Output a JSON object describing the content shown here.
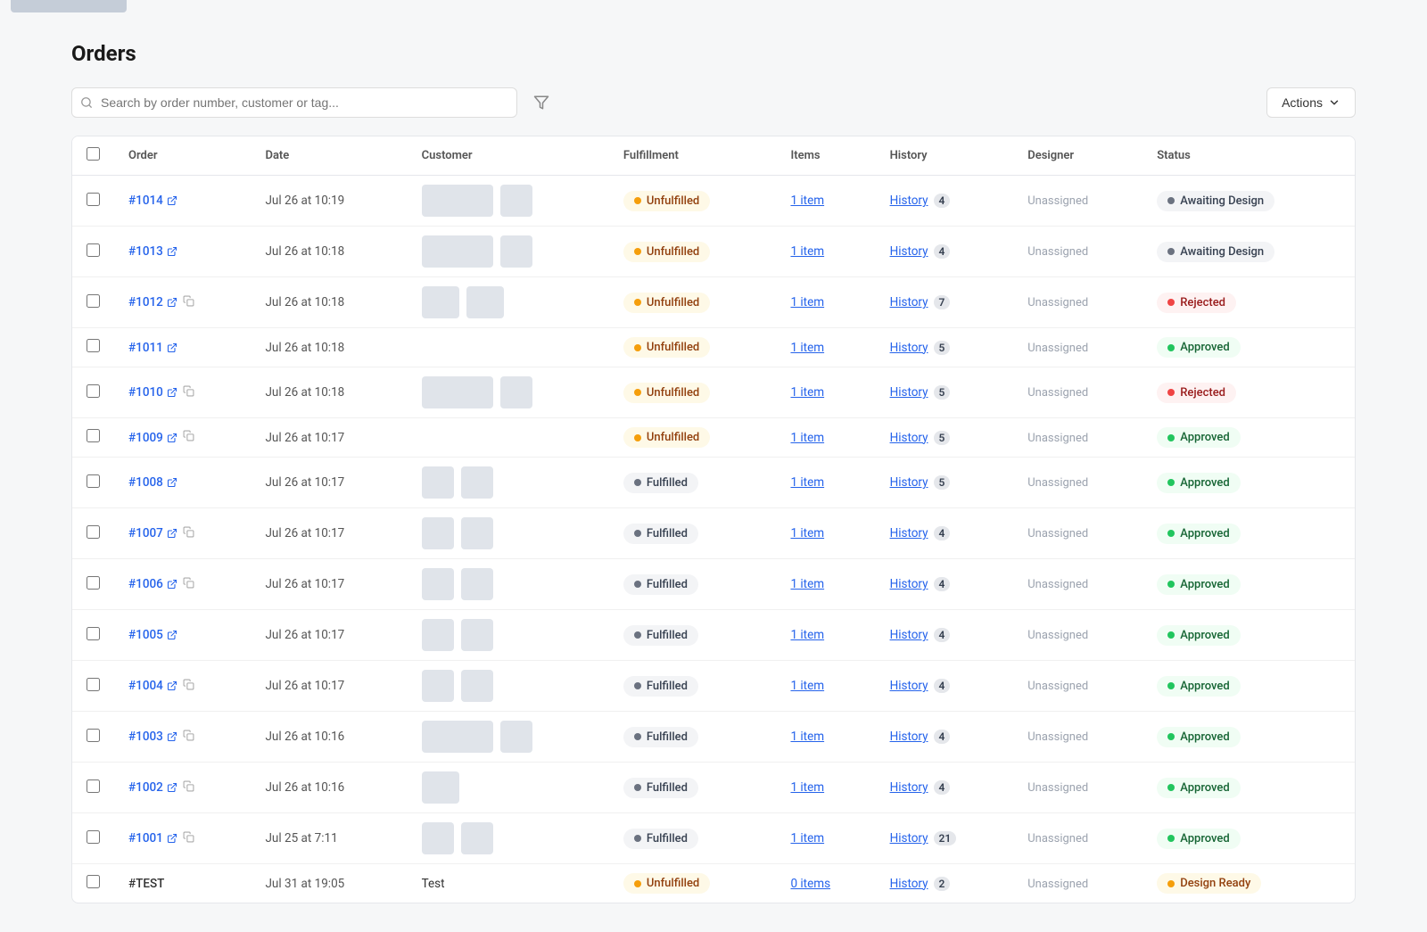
{
  "topbar": {
    "label": "top-bar"
  },
  "page": {
    "title": "Orders"
  },
  "toolbar": {
    "search_placeholder": "Search by order number, customer or tag...",
    "actions_label": "Actions"
  },
  "table": {
    "columns": [
      "",
      "Order",
      "Date",
      "Customer",
      "Fulfillment",
      "Items",
      "History",
      "Designer",
      "Status"
    ],
    "rows": [
      {
        "id": "row-1014",
        "order": "#1014",
        "date": "Jul 26 at 10:19",
        "has_customer_image": true,
        "image_type": "wide",
        "fulfillment": "Unfulfilled",
        "fulfillment_type": "unfulfilled",
        "items": "1 item",
        "history": "History",
        "history_count": 4,
        "designer": "Unassigned",
        "status": "Awaiting Design",
        "status_type": "awaiting",
        "has_copy": false
      },
      {
        "id": "row-1013",
        "order": "#1013",
        "date": "Jul 26 at 10:18",
        "has_customer_image": true,
        "image_type": "wide",
        "fulfillment": "Unfulfilled",
        "fulfillment_type": "unfulfilled",
        "items": "1 item",
        "history": "History",
        "history_count": 4,
        "designer": "Unassigned",
        "status": "Awaiting Design",
        "status_type": "awaiting",
        "has_copy": false
      },
      {
        "id": "row-1012",
        "order": "#1012",
        "date": "Jul 26 at 10:18",
        "has_customer_image": true,
        "image_type": "pair",
        "fulfillment": "Unfulfilled",
        "fulfillment_type": "unfulfilled",
        "items": "1 item",
        "history": "History",
        "history_count": 7,
        "designer": "Unassigned",
        "status": "Rejected",
        "status_type": "rejected",
        "has_copy": true
      },
      {
        "id": "row-1011",
        "order": "#1011",
        "date": "Jul 26 at 10:18",
        "has_customer_image": false,
        "image_type": "none",
        "fulfillment": "Unfulfilled",
        "fulfillment_type": "unfulfilled",
        "items": "1 item",
        "history": "History",
        "history_count": 5,
        "designer": "Unassigned",
        "status": "Approved",
        "status_type": "approved",
        "has_copy": false
      },
      {
        "id": "row-1010",
        "order": "#1010",
        "date": "Jul 26 at 10:18",
        "has_customer_image": true,
        "image_type": "wide",
        "fulfillment": "Unfulfilled",
        "fulfillment_type": "unfulfilled",
        "items": "1 item",
        "history": "History",
        "history_count": 5,
        "designer": "Unassigned",
        "status": "Rejected",
        "status_type": "rejected",
        "has_copy": true
      },
      {
        "id": "row-1009",
        "order": "#1009",
        "date": "Jul 26 at 10:17",
        "has_customer_image": false,
        "image_type": "none",
        "fulfillment": "Unfulfilled",
        "fulfillment_type": "unfulfilled",
        "items": "1 item",
        "history": "History",
        "history_count": 5,
        "designer": "Unassigned",
        "status": "Approved",
        "status_type": "approved",
        "has_copy": true
      },
      {
        "id": "row-1008",
        "order": "#1008",
        "date": "Jul 26 at 10:17",
        "has_customer_image": true,
        "image_type": "pair-sm",
        "fulfillment": "Fulfilled",
        "fulfillment_type": "fulfilled",
        "items": "1 item",
        "history": "History",
        "history_count": 5,
        "designer": "Unassigned",
        "status": "Approved",
        "status_type": "approved",
        "has_copy": false
      },
      {
        "id": "row-1007",
        "order": "#1007",
        "date": "Jul 26 at 10:17",
        "has_customer_image": true,
        "image_type": "pair-sm",
        "fulfillment": "Fulfilled",
        "fulfillment_type": "fulfilled",
        "items": "1 item",
        "history": "History",
        "history_count": 4,
        "designer": "Unassigned",
        "status": "Approved",
        "status_type": "approved",
        "has_copy": true
      },
      {
        "id": "row-1006",
        "order": "#1006",
        "date": "Jul 26 at 10:17",
        "has_customer_image": true,
        "image_type": "pair-sm",
        "fulfillment": "Fulfilled",
        "fulfillment_type": "fulfilled",
        "items": "1 item",
        "history": "History",
        "history_count": 4,
        "designer": "Unassigned",
        "status": "Approved",
        "status_type": "approved",
        "has_copy": true
      },
      {
        "id": "row-1005",
        "order": "#1005",
        "date": "Jul 26 at 10:17",
        "has_customer_image": true,
        "image_type": "pair-sm",
        "fulfillment": "Fulfilled",
        "fulfillment_type": "fulfilled",
        "items": "1 item",
        "history": "History",
        "history_count": 4,
        "designer": "Unassigned",
        "status": "Approved",
        "status_type": "approved",
        "has_copy": false
      },
      {
        "id": "row-1004",
        "order": "#1004",
        "date": "Jul 26 at 10:17",
        "has_customer_image": true,
        "image_type": "pair-sm",
        "fulfillment": "Fulfilled",
        "fulfillment_type": "fulfilled",
        "items": "1 item",
        "history": "History",
        "history_count": 4,
        "designer": "Unassigned",
        "status": "Approved",
        "status_type": "approved",
        "has_copy": true
      },
      {
        "id": "row-1003",
        "order": "#1003",
        "date": "Jul 26 at 10:16",
        "has_customer_image": true,
        "image_type": "wide",
        "fulfillment": "Fulfilled",
        "fulfillment_type": "fulfilled",
        "items": "1 item",
        "history": "History",
        "history_count": 4,
        "designer": "Unassigned",
        "status": "Approved",
        "status_type": "approved",
        "has_copy": true
      },
      {
        "id": "row-1002",
        "order": "#1002",
        "date": "Jul 26 at 10:16",
        "has_customer_image": true,
        "image_type": "sm",
        "fulfillment": "Fulfilled",
        "fulfillment_type": "fulfilled",
        "items": "1 item",
        "history": "History",
        "history_count": 4,
        "designer": "Unassigned",
        "status": "Approved",
        "status_type": "approved",
        "has_copy": true
      },
      {
        "id": "row-1001",
        "order": "#1001",
        "date": "Jul 25 at 7:11",
        "has_customer_image": true,
        "image_type": "pair-sm",
        "fulfillment": "Fulfilled",
        "fulfillment_type": "fulfilled",
        "items": "1 item",
        "history": "History",
        "history_count": 21,
        "designer": "Unassigned",
        "status": "Approved",
        "status_type": "approved",
        "has_copy": true
      },
      {
        "id": "row-test",
        "order": "#TEST",
        "date": "Jul 31 at 19:05",
        "has_customer_image": false,
        "image_type": "none",
        "customer_name": "Test",
        "fulfillment": "Unfulfilled",
        "fulfillment_type": "unfulfilled",
        "items": "0 items",
        "history": "History",
        "history_count": 2,
        "designer": "Unassigned",
        "status": "Design Ready",
        "status_type": "design-ready",
        "has_copy": false
      }
    ]
  }
}
